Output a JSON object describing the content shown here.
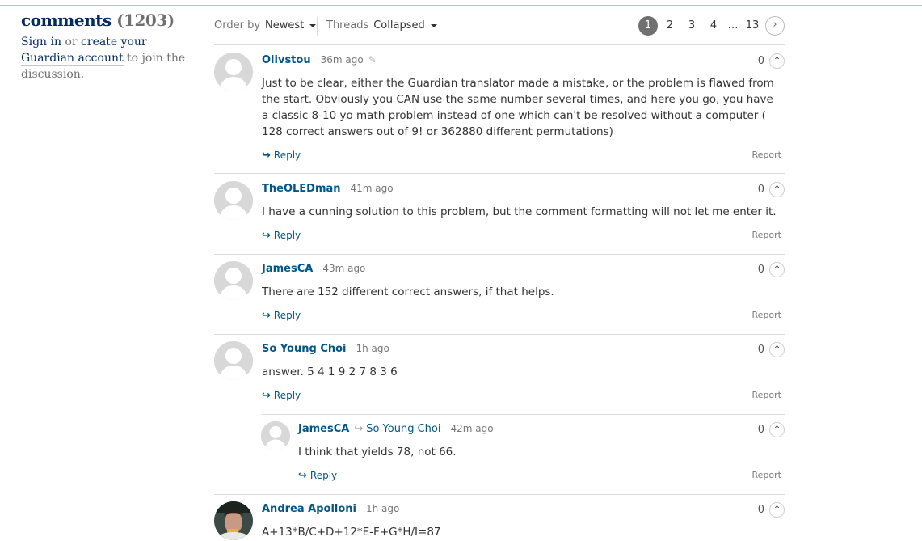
{
  "sidebar": {
    "title": "comments",
    "count": "(1203)",
    "sign_in": "Sign in",
    "or_text": " or ",
    "create_account": "create your Guardian account",
    "suffix": " to join the discussion."
  },
  "toolbar": {
    "order_label": "Order by",
    "order_value": "Newest",
    "threads_label": "Threads",
    "threads_value": "Collapsed"
  },
  "pagination": {
    "pages": [
      "1",
      "2",
      "3",
      "4"
    ],
    "ellipsis": "…",
    "last": "13",
    "next_icon": "›",
    "current": "1"
  },
  "labels": {
    "reply": "Reply",
    "report": "Report",
    "reply_arrow": "↪",
    "recommend_arrow": "↑"
  },
  "comments": [
    {
      "author": "Olivstou",
      "time": "36m ago",
      "recs": "0",
      "text": "Just to be clear, either the Guardian translator made a mistake, or the problem is flawed from the start. Obviously you CAN use the same number several times, and here you go, you have a classic 8-10 yo math problem instead of one which can't be resolved without a computer ( 128 correct answers out of 9! or 362880 different permutations)"
    },
    {
      "author": "TheOLEDman",
      "time": "41m ago",
      "recs": "0",
      "text": "I have a cunning solution to this problem, but the comment formatting will not let me enter it."
    },
    {
      "author": "JamesCA",
      "time": "43m ago",
      "recs": "0",
      "text": "There are 152 different correct answers, if that helps."
    },
    {
      "author": "So Young Choi",
      "time": "1h ago",
      "recs": "0",
      "text": "answer. 5 4 1 9 2 7 8 3 6"
    },
    {
      "author": "JamesCA",
      "reply_to": "So Young Choi",
      "time": "42m ago",
      "recs": "0",
      "text": "I think that yields 78, not 66."
    },
    {
      "author": "Andrea Apolloni",
      "time": "1h ago",
      "recs": "0",
      "text": "A+13*B/C+D+12*E-F+G*H/I=87"
    }
  ]
}
